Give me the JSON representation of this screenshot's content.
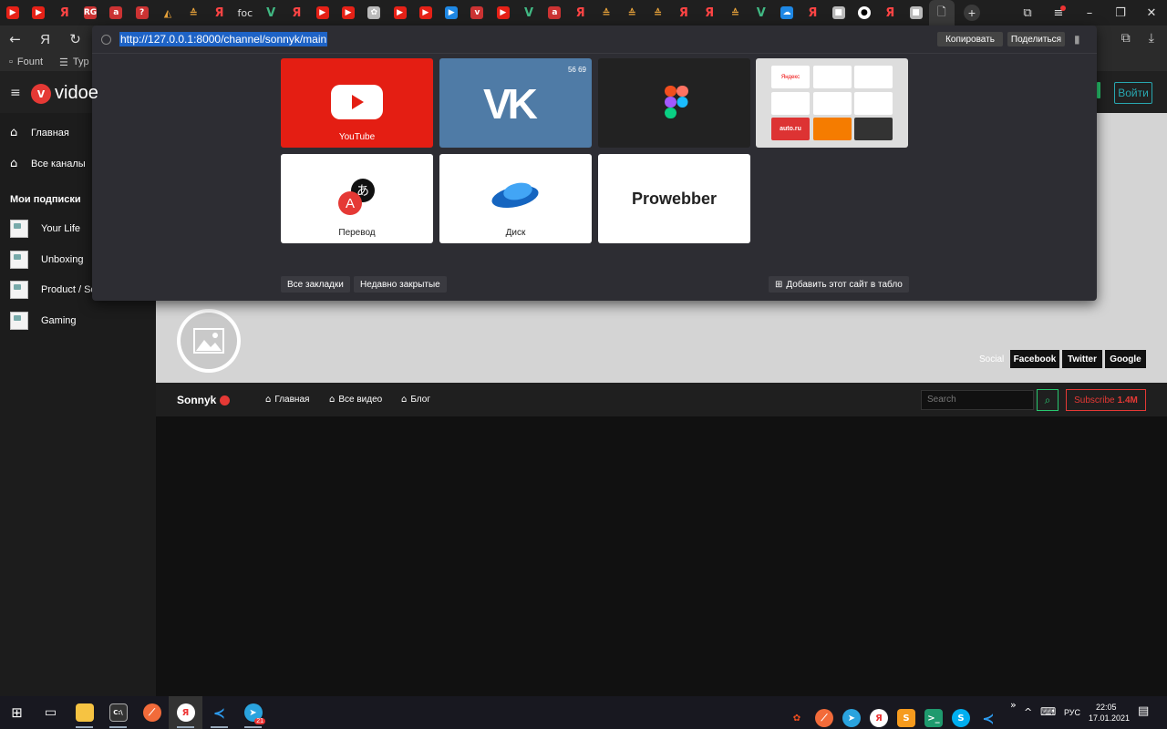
{
  "tabs": [
    {
      "kind": "yt",
      "glyph": "▶"
    },
    {
      "kind": "yt",
      "glyph": "▶"
    },
    {
      "kind": "ya",
      "glyph": "Я"
    },
    {
      "kind": "dk",
      "glyph": "RG"
    },
    {
      "kind": "dk",
      "glyph": "a"
    },
    {
      "kind": "dk",
      "glyph": "?"
    },
    {
      "kind": "ro",
      "glyph": "◭"
    },
    {
      "kind": "ro",
      "glyph": "≙"
    },
    {
      "kind": "ya",
      "glyph": "Я"
    },
    {
      "kind": "txt",
      "glyph": "foc"
    },
    {
      "kind": "v",
      "glyph": "V"
    },
    {
      "kind": "ya",
      "glyph": "Я"
    },
    {
      "kind": "yt",
      "glyph": "▶"
    },
    {
      "kind": "yt",
      "glyph": "▶"
    },
    {
      "kind": "gr",
      "glyph": "✿"
    },
    {
      "kind": "yt",
      "glyph": "▶"
    },
    {
      "kind": "yt",
      "glyph": "▶"
    },
    {
      "kind": "bl",
      "glyph": "▶"
    },
    {
      "kind": "dk",
      "glyph": "v"
    },
    {
      "kind": "yt",
      "glyph": "▶"
    },
    {
      "kind": "v",
      "glyph": "V"
    },
    {
      "kind": "dk",
      "glyph": "a"
    },
    {
      "kind": "ya",
      "glyph": "Я"
    },
    {
      "kind": "ro",
      "glyph": "≙"
    },
    {
      "kind": "ro",
      "glyph": "≙"
    },
    {
      "kind": "ro",
      "glyph": "≙"
    },
    {
      "kind": "ya",
      "glyph": "Я"
    },
    {
      "kind": "ya",
      "glyph": "Я"
    },
    {
      "kind": "ro",
      "glyph": "≙"
    },
    {
      "kind": "v",
      "glyph": "V"
    },
    {
      "kind": "bl",
      "glyph": "☁"
    },
    {
      "kind": "ya",
      "glyph": "Я"
    },
    {
      "kind": "gr",
      "glyph": "■"
    },
    {
      "kind": "gh",
      "glyph": "●"
    },
    {
      "kind": "ya",
      "glyph": "Я"
    },
    {
      "kind": "gr",
      "glyph": "■"
    }
  ],
  "bookmarks": {
    "fount": "Fount",
    "typ": "Typ"
  },
  "omnibox": {
    "url": "http://127.0.0.1:8000/channel/sonnyk/main",
    "copy": "Копировать",
    "share": "Поделиться",
    "all_bookmarks": "Все закладки",
    "recently_closed": "Недавно закрытые",
    "add_site": "Добавить этот сайт в табло",
    "tiles": {
      "youtube": "YouTube",
      "vk_badges": "56  69",
      "translate": "Перевод",
      "disk": "Диск",
      "prowebber": "Prowebber"
    },
    "mini_tiles": [
      "Яндекс",
      "",
      "",
      "",
      "",
      "",
      "auto.ru",
      "",
      ""
    ]
  },
  "site": {
    "logo_letter": "v",
    "logo_text": "vidoe",
    "login": "Войти",
    "nav": [
      {
        "icon": "home-icon",
        "label": "Главная"
      },
      {
        "icon": "home-icon",
        "label": "Все каналы"
      }
    ],
    "subs_title": "Мои подписки",
    "subs": [
      "Your Life",
      "Unboxing",
      "Product / Ser",
      "Gaming"
    ],
    "social_label": "Social",
    "social": [
      "Facebook",
      "Twitter",
      "Google"
    ],
    "channel_name": "Sonnyk",
    "channel_nav": [
      "Главная",
      "Все видео",
      "Блог"
    ],
    "search_placeholder": "Search",
    "subscribe": "Subscribe",
    "subscribers": "1.4M"
  },
  "taskbar": {
    "lang": "РУС",
    "time": "22:05",
    "date": "17.01.2021",
    "notif": "1",
    "tg_badge": "21"
  }
}
